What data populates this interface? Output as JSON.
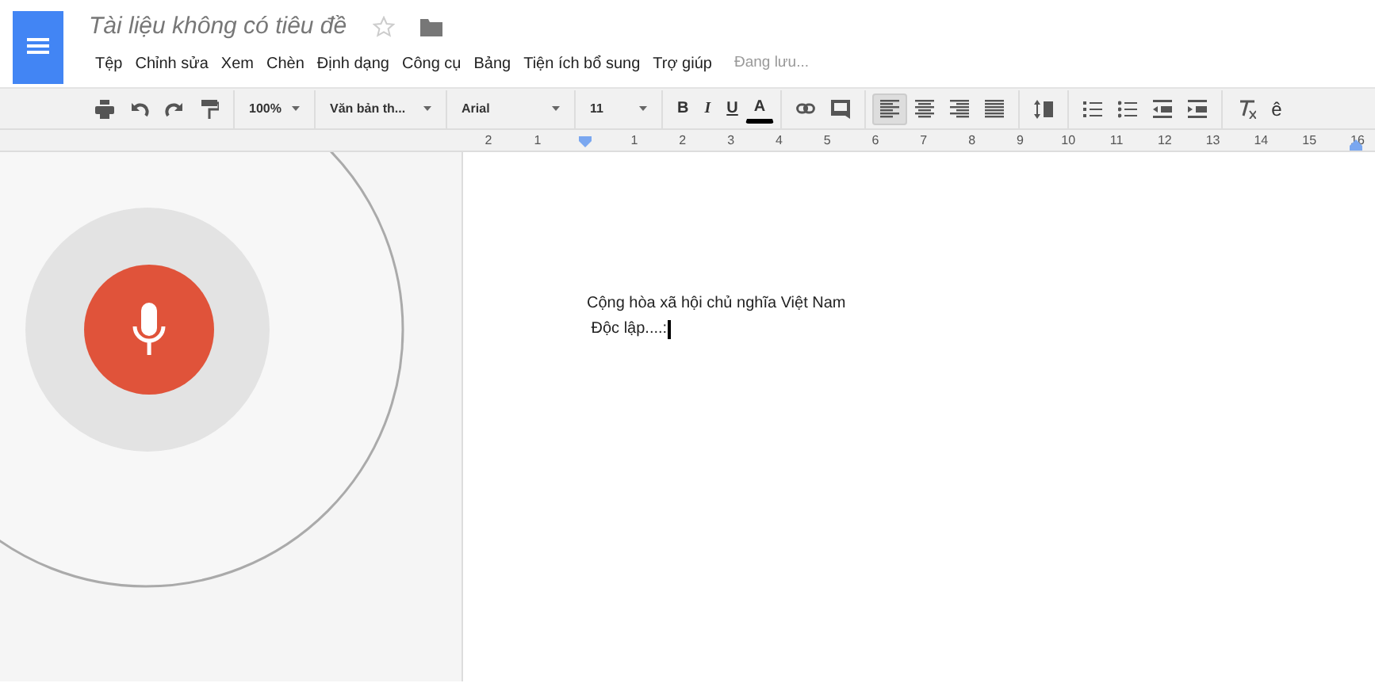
{
  "document": {
    "title": "Tài liệu không có tiêu đề",
    "starred": false
  },
  "menu": [
    "Tệp",
    "Chỉnh sửa",
    "Xem",
    "Chèn",
    "Định dạng",
    "Công cụ",
    "Bảng",
    "Tiện ích bổ sung",
    "Trợ giúp"
  ],
  "save_status": "Đang lưu...",
  "toolbar": {
    "zoom": "100%",
    "style": "Văn bản th...",
    "font": "Arial",
    "size": "11",
    "format": [
      "B",
      "I",
      "U",
      "A"
    ],
    "align": [
      {
        "selected": true
      },
      {
        "selected": false
      },
      {
        "selected": false
      },
      {
        "selected": false
      }
    ],
    "input_tools": "ê"
  },
  "ruler": [
    "2",
    "1",
    "1",
    "2",
    "3",
    "4",
    "5",
    "6",
    "7",
    "8",
    "9",
    "10",
    "11",
    "12",
    "13",
    "14",
    "15",
    "16"
  ],
  "voice_typing": {
    "listening": true
  },
  "body": [
    "Cộng hòa xã hội chủ nghĩa Việt Nam",
    " Độc lập....:"
  ]
}
